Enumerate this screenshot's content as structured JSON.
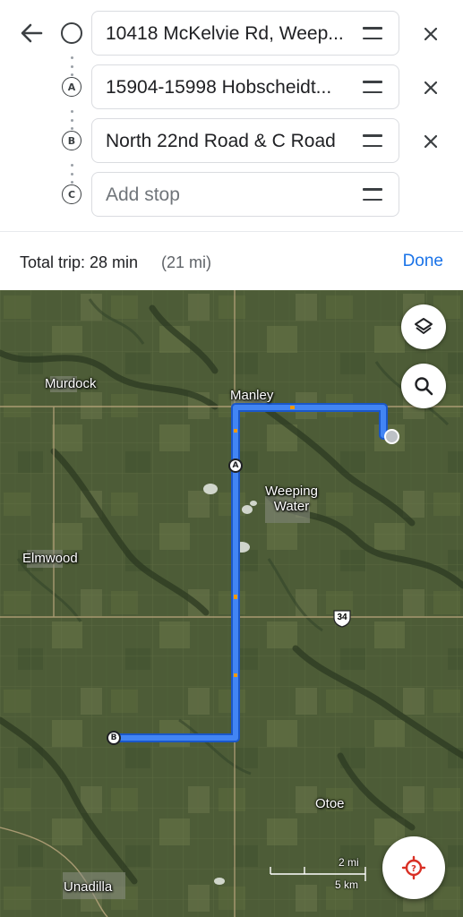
{
  "header": {
    "back_icon": "arrow-left-icon",
    "stops": [
      {
        "marker": "",
        "marker_icon": "circle-origin-icon",
        "text": "10418 McKelvie Rd, Weep...",
        "placeholder": false,
        "removable": true
      },
      {
        "marker": "A",
        "marker_icon": "letter-a-marker-icon",
        "text": "15904-15998 Hobscheidt...",
        "placeholder": false,
        "removable": true
      },
      {
        "marker": "B",
        "marker_icon": "letter-b-marker-icon",
        "text": "North 22nd Road & C Road",
        "placeholder": false,
        "removable": true
      },
      {
        "marker": "C",
        "marker_icon": "letter-c-marker-icon",
        "text": "Add stop",
        "placeholder": true,
        "removable": false
      }
    ]
  },
  "trip": {
    "label": "Total trip: 28 min",
    "distance": "(21 mi)",
    "done_label": "Done"
  },
  "map": {
    "places": {
      "murdock": "Murdock",
      "manley": "Manley",
      "weeping_water": "Weeping\nWater",
      "elmwood": "Elmwood",
      "otoe": "Otoe",
      "unadilla": "Unadilla"
    },
    "highway_shield": "34",
    "route_marker_a": "A",
    "route_marker_b": "B",
    "scale": {
      "miles": "2 mi",
      "km": "5 km"
    },
    "route_color": "#4285f4",
    "buttons": {
      "layers_icon": "layers-icon",
      "search_icon": "search-icon",
      "location_icon": "my-location-icon"
    }
  }
}
